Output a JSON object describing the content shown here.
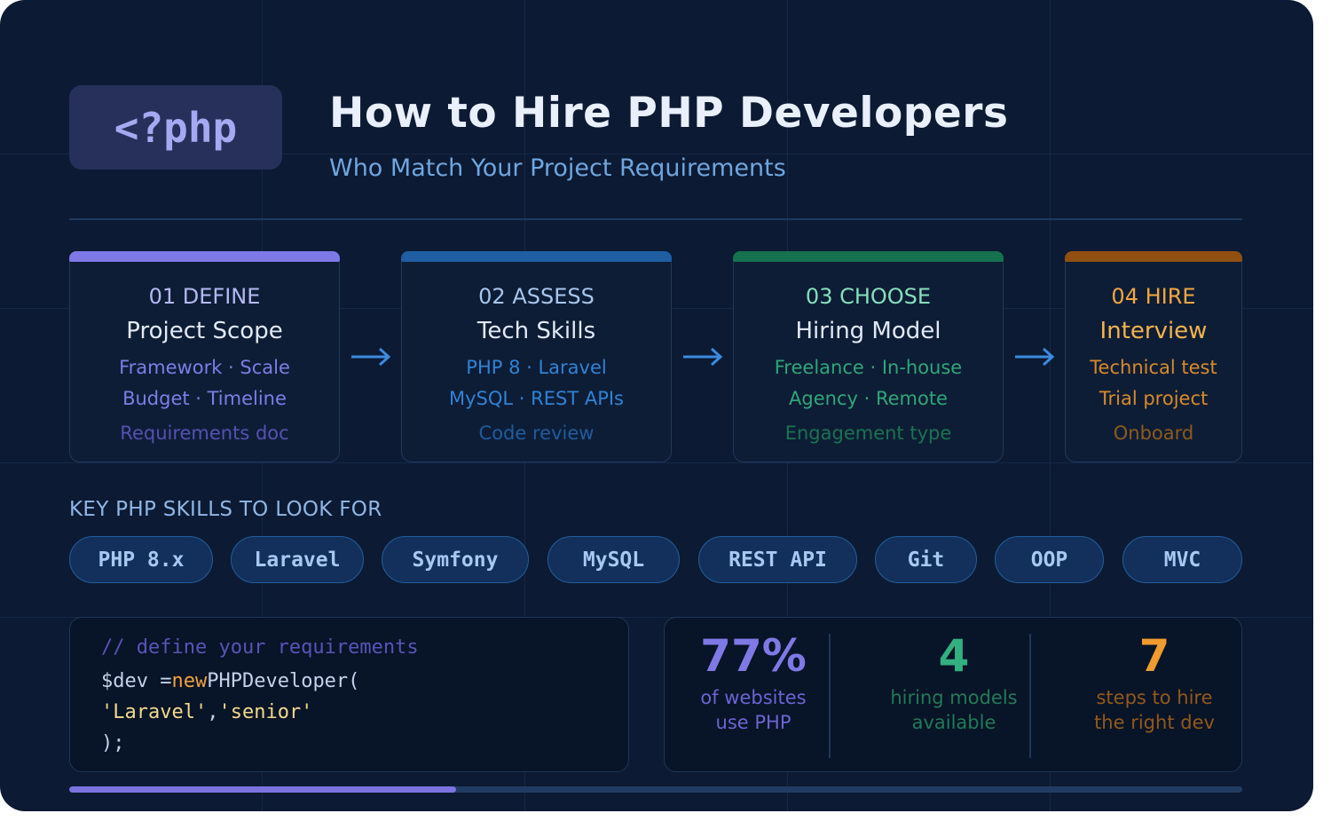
{
  "header": {
    "badge": "<?php",
    "title": "How to Hire PHP Developers",
    "subtitle": "Who Match Your Project Requirements"
  },
  "colors": {
    "background": "#0c1a33",
    "define": "#7f79e6",
    "assess": "#2f86d6",
    "choose": "#32b07f",
    "hire": "#e2922c"
  },
  "steps": [
    {
      "step": "01 DEFINE",
      "name": "Project Scope",
      "line1": "Framework · Scale",
      "line2": "Budget · Timeline",
      "line3": "Requirements doc"
    },
    {
      "step": "02 ASSESS",
      "name": "Tech Skills",
      "line1": "PHP 8 · Laravel",
      "line2": "MySQL · REST APIs",
      "line3": "Code review"
    },
    {
      "step": "03 CHOOSE",
      "name": "Hiring Model",
      "line1": "Freelance · In-house",
      "line2": "Agency · Remote",
      "line3": "Engagement type"
    },
    {
      "step": "04 HIRE",
      "name": "Interview",
      "line1": "Technical test",
      "line2": "Trial project",
      "line3": "Onboard"
    }
  ],
  "skills": {
    "heading": "KEY PHP SKILLS TO LOOK FOR",
    "chips": [
      "PHP 8.x",
      "Laravel",
      "Symfony",
      "MySQL",
      "REST API",
      "Git",
      "OOP",
      "MVC"
    ]
  },
  "code": {
    "comment": "// define your requirements",
    "var": "$dev =",
    "keyword": "new",
    "cls": "PHPDeveloper(",
    "arg1": "'Laravel'",
    "comma": ",",
    "arg2": "'senior'",
    "close": ");"
  },
  "stats": [
    {
      "value": "77%",
      "line1": "of websites",
      "line2": "use PHP"
    },
    {
      "value": "4",
      "line1": "hiring models",
      "line2": "available"
    },
    {
      "value": "7",
      "line1": "steps to hire",
      "line2": "the right dev"
    }
  ],
  "progress": {
    "fraction": 0.33
  }
}
